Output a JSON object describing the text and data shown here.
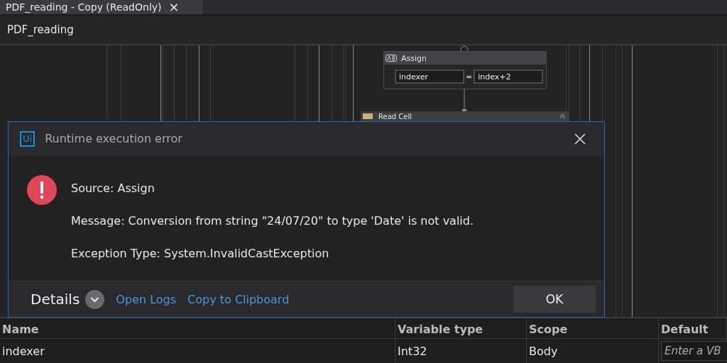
{
  "tab": {
    "title": "PDF_reading - Copy (ReadOnly)",
    "close": "×"
  },
  "breadcrumb": "PDF_reading",
  "designer": {
    "assign": {
      "title": "Assign",
      "to": "indexer",
      "operator": "=",
      "value": "index+2"
    },
    "read_cell": {
      "title": "Read Cell"
    }
  },
  "dialog": {
    "logo": "Ui",
    "title": "Runtime execution error",
    "lines": [
      {
        "label": "Source: Assign"
      },
      {
        "label": "Message: Conversion from string \"24/07/20\" to type 'Date' is not valid."
      },
      {
        "label": "Exception Type: System.InvalidCastException"
      }
    ],
    "details": "Details",
    "expanded": false,
    "links": [
      "Open Logs",
      "Copy to Clipboard"
    ],
    "ok": "OK"
  },
  "variables": {
    "columns": [
      "Name",
      "Variable type",
      "Scope",
      "Default"
    ],
    "rows": [
      {
        "name": "indexer",
        "type": "Int32",
        "scope": "Body",
        "default_placeholder": "Enter a VB"
      }
    ]
  }
}
